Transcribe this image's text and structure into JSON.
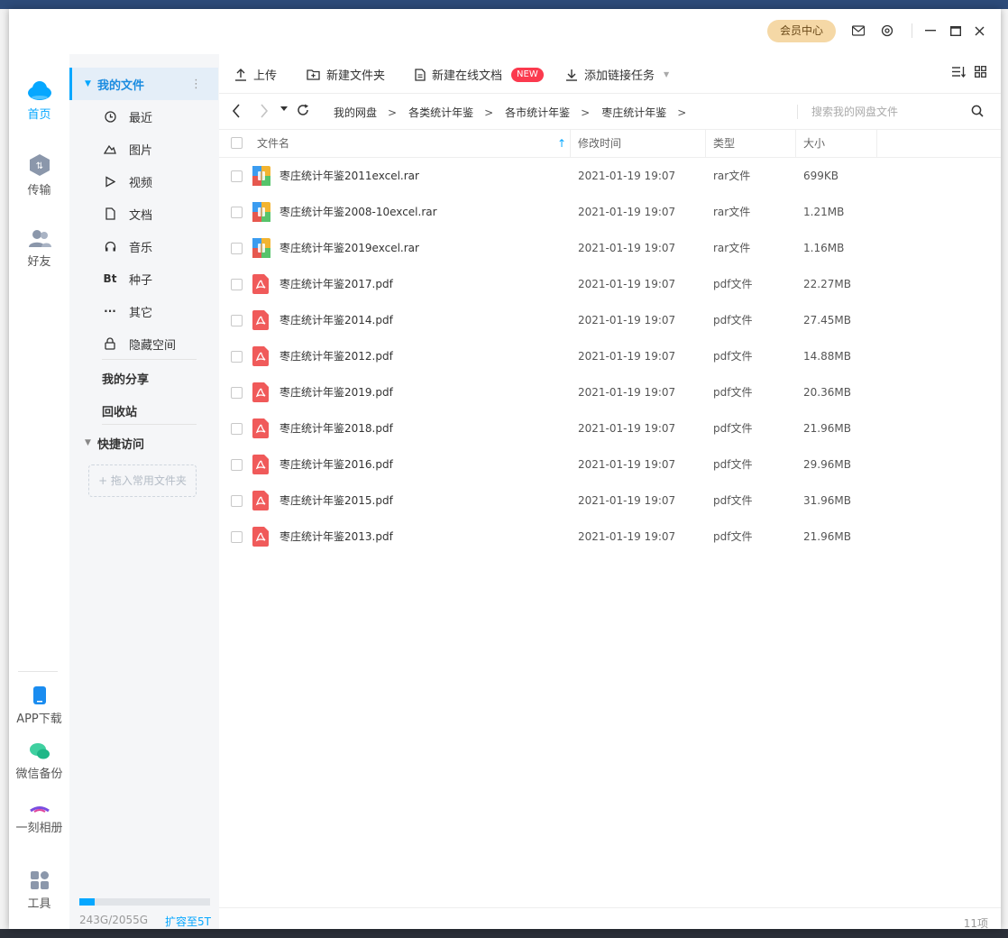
{
  "titlebar": {
    "vip_label": "会员中心"
  },
  "nav": {
    "home": "首页",
    "transfer": "传输",
    "friends": "好友",
    "app_download": "APP下载",
    "wechat_backup": "微信备份",
    "album": "一刻相册",
    "tools": "工具"
  },
  "sidebar": {
    "my_files": "我的文件",
    "items": [
      {
        "label": "最近",
        "icon": "clock-icon"
      },
      {
        "label": "图片",
        "icon": "picture-icon"
      },
      {
        "label": "视频",
        "icon": "video-icon"
      },
      {
        "label": "文档",
        "icon": "document-icon"
      },
      {
        "label": "音乐",
        "icon": "headphones-icon"
      },
      {
        "label": "种子",
        "icon": "bt-icon",
        "glyph": "Bt"
      },
      {
        "label": "其它",
        "icon": "more-icon",
        "glyph": "···"
      },
      {
        "label": "隐藏空间",
        "icon": "lock-icon"
      }
    ],
    "my_share": "我的分享",
    "recycle": "回收站",
    "quick_access": "快捷访问",
    "add_fav": "+ 拖入常用文件夹",
    "quota_text": "243G/2055G",
    "quota_fraction": 0.118,
    "expand": "扩容至5T"
  },
  "toolbar": {
    "upload": "上传",
    "new_folder": "新建文件夹",
    "new_online_doc": "新建在线文档",
    "new_badge": "NEW",
    "add_link_task": "添加链接任务"
  },
  "breadcrumb": [
    "我的网盘",
    "各类统计年鉴",
    "各市统计年鉴",
    "枣庄统计年鉴"
  ],
  "search": {
    "placeholder": "搜索我的网盘文件"
  },
  "table": {
    "headers": {
      "name": "文件名",
      "modified": "修改时间",
      "type": "类型",
      "size": "大小"
    },
    "rows": [
      {
        "name": "枣庄统计年鉴2011excel.rar",
        "time": "2021-01-19 19:07",
        "type": "rar文件",
        "size": "699KB",
        "kind": "rar"
      },
      {
        "name": "枣庄统计年鉴2008-10excel.rar",
        "time": "2021-01-19 19:07",
        "type": "rar文件",
        "size": "1.21MB",
        "kind": "rar"
      },
      {
        "name": "枣庄统计年鉴2019excel.rar",
        "time": "2021-01-19 19:07",
        "type": "rar文件",
        "size": "1.16MB",
        "kind": "rar"
      },
      {
        "name": "枣庄统计年鉴2017.pdf",
        "time": "2021-01-19 19:07",
        "type": "pdf文件",
        "size": "22.27MB",
        "kind": "pdf"
      },
      {
        "name": "枣庄统计年鉴2014.pdf",
        "time": "2021-01-19 19:07",
        "type": "pdf文件",
        "size": "27.45MB",
        "kind": "pdf"
      },
      {
        "name": "枣庄统计年鉴2012.pdf",
        "time": "2021-01-19 19:07",
        "type": "pdf文件",
        "size": "14.88MB",
        "kind": "pdf"
      },
      {
        "name": "枣庄统计年鉴2019.pdf",
        "time": "2021-01-19 19:07",
        "type": "pdf文件",
        "size": "20.36MB",
        "kind": "pdf"
      },
      {
        "name": "枣庄统计年鉴2018.pdf",
        "time": "2021-01-19 19:07",
        "type": "pdf文件",
        "size": "21.96MB",
        "kind": "pdf"
      },
      {
        "name": "枣庄统计年鉴2016.pdf",
        "time": "2021-01-19 19:07",
        "type": "pdf文件",
        "size": "29.96MB",
        "kind": "pdf"
      },
      {
        "name": "枣庄统计年鉴2015.pdf",
        "time": "2021-01-19 19:07",
        "type": "pdf文件",
        "size": "31.96MB",
        "kind": "pdf"
      },
      {
        "name": "枣庄统计年鉴2013.pdf",
        "time": "2021-01-19 19:07",
        "type": "pdf文件",
        "size": "21.96MB",
        "kind": "pdf"
      }
    ]
  },
  "footer": {
    "count": "11项"
  },
  "colors": {
    "accent": "#06a7ff",
    "pdf": "#f05a5a",
    "vip_bg": "#f5d8a6",
    "badge": "#fb3a4e"
  }
}
